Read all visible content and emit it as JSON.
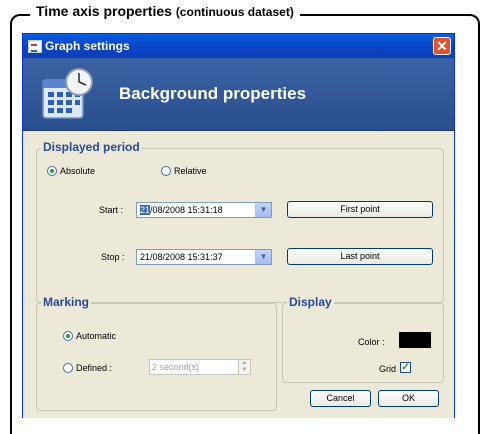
{
  "caption": {
    "title": "Time axis properties",
    "subtitle": "(continuous dataset)"
  },
  "window": {
    "title": "Graph settings",
    "close_label": "✕"
  },
  "banner": {
    "title": "Background properties"
  },
  "period": {
    "legend": "Displayed period",
    "absolute_label": "Absolute",
    "relative_label": "Relative",
    "selected": "Absolute",
    "start_label": "Start :",
    "start_day": "21",
    "start_rest": "/08/2008 15:31:18",
    "first_point_label": "First point",
    "stop_label": "Stop :",
    "stop_value": "21/08/2008 15:31:37",
    "last_point_label": "Last point"
  },
  "marking": {
    "legend": "Marking",
    "automatic_label": "Automatic",
    "defined_label": "Defined :",
    "selected": "Automatic",
    "defined_value": "2 second(s)"
  },
  "display": {
    "legend": "Display",
    "color_label": "Color :",
    "color_value": "#000000",
    "grid_label": "Grid",
    "grid_checked": true
  },
  "buttons": {
    "cancel_label": "Cancel",
    "ok_label": "OK"
  },
  "icons": {
    "banner": "calendar-clock-icon",
    "app": "graph-app-icon",
    "check": "checkmark-icon"
  }
}
